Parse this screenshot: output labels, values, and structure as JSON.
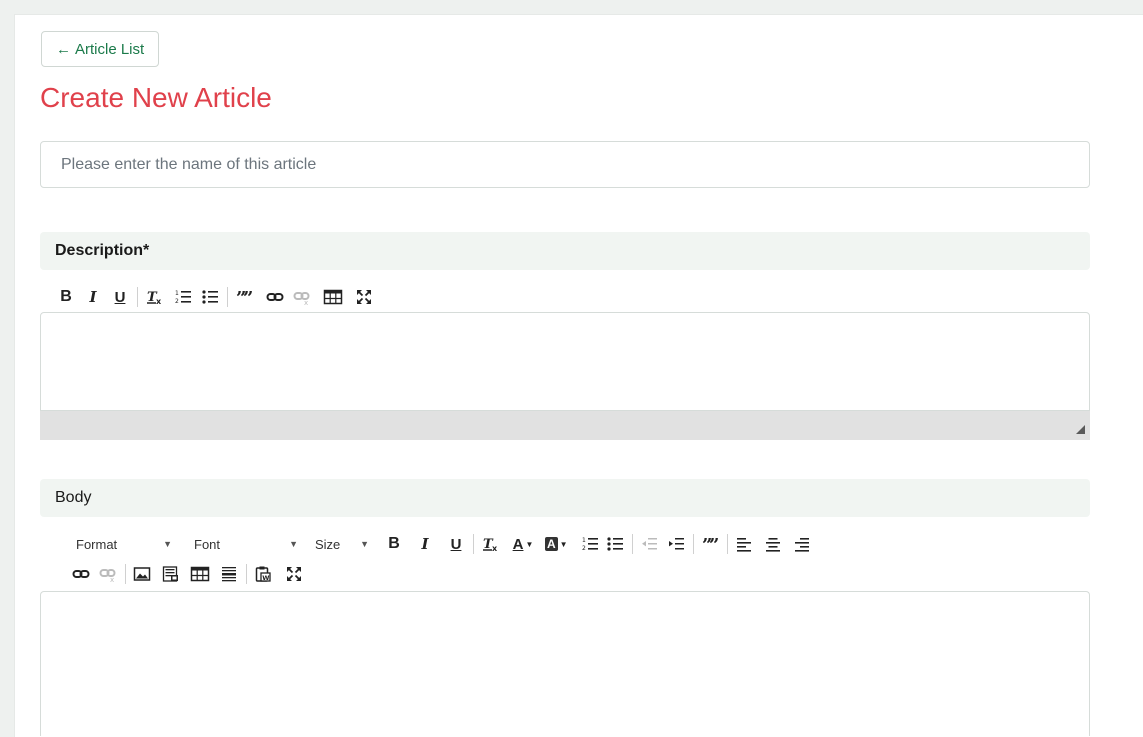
{
  "back_button": {
    "label": "Article List"
  },
  "page_title": "Create New Article",
  "name_field": {
    "value": "",
    "placeholder": "Please enter the name of this article"
  },
  "description": {
    "label": "Description*",
    "toolbar": [
      "Bold",
      "Italic",
      "Underline",
      "Remove Format",
      "Numbered List",
      "Bulleted List",
      "Blockquote",
      "Link",
      "Unlink",
      "Table",
      "Maximize"
    ],
    "bold_glyph": "B",
    "italic_glyph": "I",
    "underline_glyph": "U"
  },
  "body": {
    "label": "Body",
    "format_label": "Format",
    "font_label": "Font",
    "size_label": "Size",
    "bold_glyph": "B",
    "italic_glyph": "I",
    "underline_glyph": "U",
    "text_color_glyph": "A",
    "bg_color_glyph": "A"
  },
  "colors": {
    "accent_title": "#e0414b",
    "link_green": "#1b7a4a",
    "section_bg": "#f1f5f2",
    "statusbar": "#e1e1e1"
  },
  "icons": [
    "arrow-left-icon",
    "remove-format-icon",
    "numbered-list-icon",
    "bulleted-list-icon",
    "blockquote-icon",
    "link-icon",
    "unlink-icon",
    "table-icon",
    "maximize-icon",
    "outdent-icon",
    "indent-icon",
    "align-left-icon",
    "align-center-icon",
    "align-right-icon",
    "image-icon",
    "embed-icon",
    "horizontal-line-icon",
    "paste-word-icon"
  ]
}
